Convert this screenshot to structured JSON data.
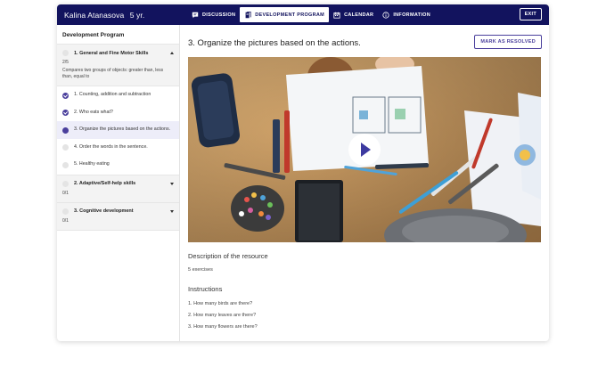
{
  "header": {
    "student_name": "Kalina Atanasova",
    "student_age": "5 yr.",
    "nav": [
      {
        "label": "DISCUSSION",
        "icon": "chat-icon"
      },
      {
        "label": "DEVELOPMENT PROGRAM",
        "icon": "book-icon",
        "active": true
      },
      {
        "label": "CALENDAR",
        "icon": "calendar-icon"
      },
      {
        "label": "INFORMATION",
        "icon": "info-icon"
      }
    ],
    "exit_label": "EXIT"
  },
  "sidebar": {
    "title": "Development Program",
    "sections": [
      {
        "name": "1. General and Fine Motor Skills",
        "count": "2/5",
        "description": "Compares two groups of objects: greater than, less than, equal to",
        "expanded": true,
        "lessons": [
          {
            "label": "1. Counting, addition and subtraction",
            "status": "done"
          },
          {
            "label": "2. Who eats what?",
            "status": "done"
          },
          {
            "label": "3. Organize the pictures based on the actions.",
            "status": "current"
          },
          {
            "label": "4. Order the words in the sentence.",
            "status": "todo"
          },
          {
            "label": "5. Healthy eating",
            "status": "todo"
          }
        ]
      },
      {
        "name": "2. Adaptive/Self-help skills",
        "count": "0/1",
        "expanded": false
      },
      {
        "name": "3. Cognitive development",
        "count": "0/1",
        "expanded": false
      }
    ]
  },
  "main": {
    "title": "3. Organize the pictures based on the actions.",
    "resolve_label": "MARK AS RESOLVED",
    "description_heading": "Description of the resource",
    "exercise_count": "5 exercises",
    "instructions_heading": "Instructions",
    "instructions": [
      "1. How many birds are there?",
      "2. How many leaves are there?",
      "3. How many flowers are there?"
    ]
  },
  "colors": {
    "brand": "#12135e",
    "accent": "#4a3f9c",
    "selected_bg": "#ededf9"
  }
}
